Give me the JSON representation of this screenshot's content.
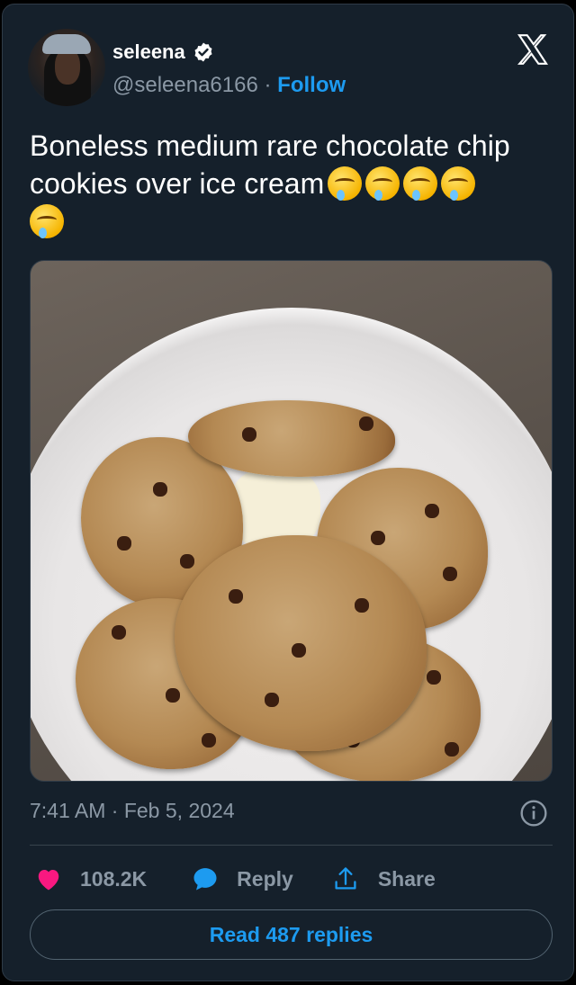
{
  "author": {
    "display_name": "seleena",
    "handle": "@seleena6166",
    "separator": "·",
    "follow_label": "Follow"
  },
  "tweet": {
    "text": "Boneless medium rare chocolate chip cookies over ice cream",
    "emoji_count": 5,
    "emoji_name": "drooling-face",
    "image_alt": "Chocolate chip cookies over ice cream in a white bowl"
  },
  "meta": {
    "time": "7:41 AM",
    "separator": "·",
    "date": "Feb 5, 2024"
  },
  "actions": {
    "likes": "108.2K",
    "reply_label": "Reply",
    "share_label": "Share"
  },
  "read_replies_label": "Read 487 replies",
  "colors": {
    "accent": "#1d9bf0",
    "background": "#15202b",
    "heart": "#f91880",
    "muted": "#8b98a5"
  }
}
